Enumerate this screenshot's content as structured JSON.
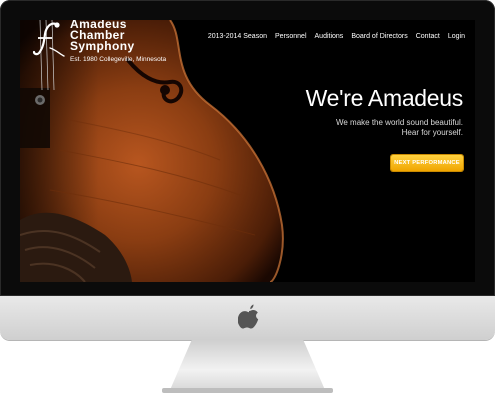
{
  "site": {
    "logo": {
      "name": "Amadeus\nChamber\nSymphony",
      "tagline": "Est. 1980 Collegeville, Minnesota"
    },
    "nav": [
      "2013-2014 Season",
      "Personnel",
      "Auditions",
      "Board of Directors",
      "Contact",
      "Login"
    ],
    "hero": {
      "title": "We're Amadeus",
      "subtitle_line1": "We make the world sound beautiful.",
      "subtitle_line2": "Hear for yourself.",
      "cta_label": "NEXT PERFORMANCE"
    }
  },
  "colors": {
    "cta_top": "#ffd23f",
    "cta_bottom": "#f0a500",
    "violin_wood": "#8a3d12",
    "background": "#000000"
  },
  "icons": [
    "apple-logo-icon",
    "violin-f-logo-icon"
  ]
}
